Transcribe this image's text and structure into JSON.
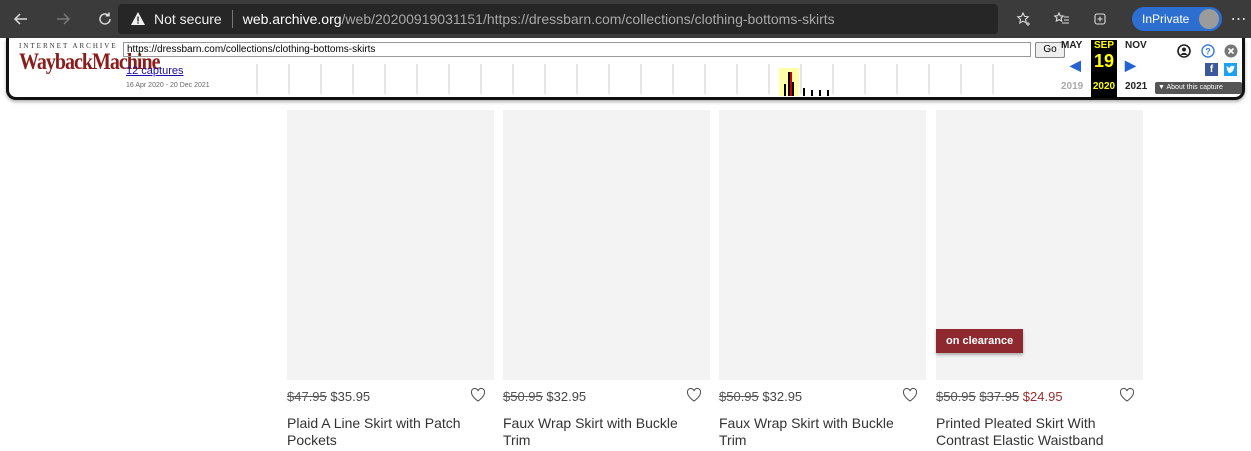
{
  "browser": {
    "security_label": "Not secure",
    "url_host": "web.archive.org",
    "url_rest": "/web/20200919031151/https://dressbarn.com/collections/clothing-bottoms-skirts",
    "inprivate_label": "InPrivate",
    "icons": [
      "back-icon",
      "forward-icon",
      "refresh-icon",
      "warning-icon",
      "add-favorite-icon",
      "favorites-icon",
      "collections-icon",
      "more-icon"
    ]
  },
  "wayback": {
    "ia_label": "INTERNET ARCHIVE",
    "logo_text": "WaybackMachine",
    "url_value": "https://dressbarn.com/collections/clothing-bottoms-skirts",
    "go_label": "Go",
    "captures_link": "12 captures",
    "date_range": "16 Apr 2020 - 20 Dec 2021",
    "prev_month": "MAY",
    "current_month": "SEP",
    "next_month": "NOV",
    "current_day": "19",
    "prev_year": "2019",
    "current_year": "2020",
    "next_year": "2021",
    "about_label": "▼ About this capture"
  },
  "products": [
    {
      "prices": {
        "old": "$47.95",
        "current": "$35.95"
      },
      "name": "Plaid A Line Skirt with Patch Pockets",
      "badge": ""
    },
    {
      "prices": {
        "old": "$50.95",
        "current": "$32.95"
      },
      "name": "Faux Wrap Skirt with Buckle Trim",
      "badge": ""
    },
    {
      "prices": {
        "old": "$50.95",
        "current": "$32.95"
      },
      "name": "Faux Wrap Skirt with Buckle Trim",
      "badge": ""
    },
    {
      "prices": {
        "old": "$50.95",
        "mid": "$37.95",
        "sale": "$24.95"
      },
      "name": "Printed Pleated Skirt With Contrast Elastic Waistband",
      "badge": "on clearance"
    }
  ],
  "colors": {
    "sale_red": "#9a2d2d",
    "badge_bg": "#8e2a2f",
    "inprivate_blue": "#2d6fd1"
  }
}
